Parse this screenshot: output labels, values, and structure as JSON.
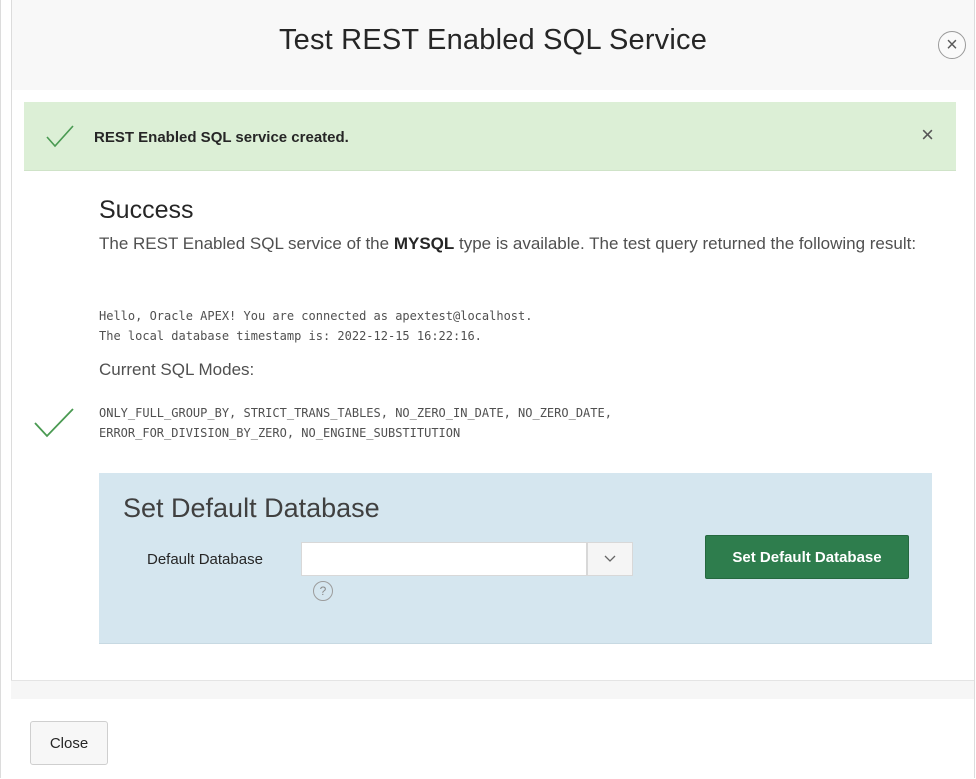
{
  "dialog": {
    "title": "Test REST Enabled SQL Service",
    "close_icon_glyph": "×"
  },
  "alert": {
    "message": "REST Enabled SQL service created.",
    "dismiss_glyph": "×",
    "color": "#dcefd6"
  },
  "result": {
    "heading": "Success",
    "text_before": "The REST Enabled SQL service of the ",
    "db_type": "MYSQL",
    "text_after": " type is available. The test query returned the following result:",
    "output_line1": "Hello, Oracle APEX! You are connected as apextest@localhost.",
    "output_line2": "The local database timestamp is: 2022-12-15 16:22:16.",
    "modes_label": "Current SQL Modes:",
    "modes_line1": "ONLY_FULL_GROUP_BY, STRICT_TRANS_TABLES, NO_ZERO_IN_DATE, NO_ZERO_DATE,",
    "modes_line2": "ERROR_FOR_DIVISION_BY_ZERO, NO_ENGINE_SUBSTITUTION"
  },
  "default_db": {
    "region_title": "Set Default Database",
    "field_label": "Default Database",
    "selected_value": "",
    "help_glyph": "?",
    "button_label": "Set Default Database",
    "button_color": "#2e7d4d"
  },
  "footer": {
    "close_label": "Close"
  }
}
